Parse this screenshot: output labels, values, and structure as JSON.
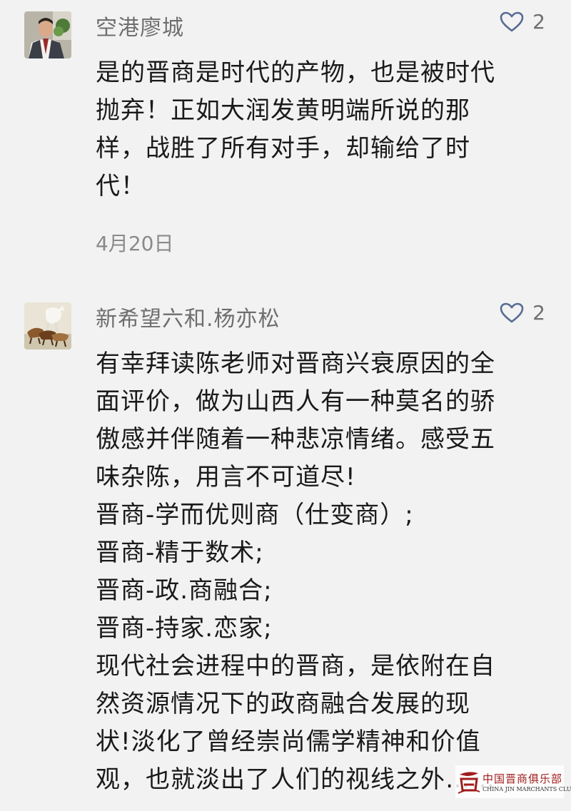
{
  "comments": [
    {
      "username": "空港廖城",
      "likes": "2",
      "avatar_icon": "avatar-man-in-suit",
      "lines": [
        "是的晋商是时代的产物，也是被时代",
        "抛弃！正如大润发黄明端所说的那",
        "样，战胜了所有对手，却输给了时",
        "代！"
      ],
      "date": "4月20日"
    },
    {
      "username": "新希望六和.杨亦松",
      "likes": "2",
      "avatar_icon": "avatar-running-horses",
      "lines": [
        "有幸拜读陈老师对晋商兴衰原因的全",
        "面评价，做为山西人有一种莫名的骄",
        "傲感并伴随着一种悲凉情绪。感受五",
        "味杂陈，用言不可道尽!",
        "晋商-学而优则商（仕变商）;",
        "晋商-精于数术;",
        "晋商-政.商融合;",
        "晋商-持家.恋家;",
        "现代社会进程中的晋商，是依附在自",
        "然资源情况下的政商融合发展的现",
        "状!淡化了曾经崇尚儒学精神和价值",
        "观，也就淡出了人们的视线之外……"
      ]
    }
  ],
  "watermark": {
    "cn": "中国晋商俱乐部",
    "en": "CHINA JIN MARCHANTS CLUB"
  },
  "colors": {
    "background": "#f2f2f2",
    "text": "#1a1a1a",
    "meta": "#6e6e6e",
    "heart": "#576b95",
    "watermark_red": "#a21c1c"
  },
  "icons": {
    "like": "heart-outline-icon"
  }
}
